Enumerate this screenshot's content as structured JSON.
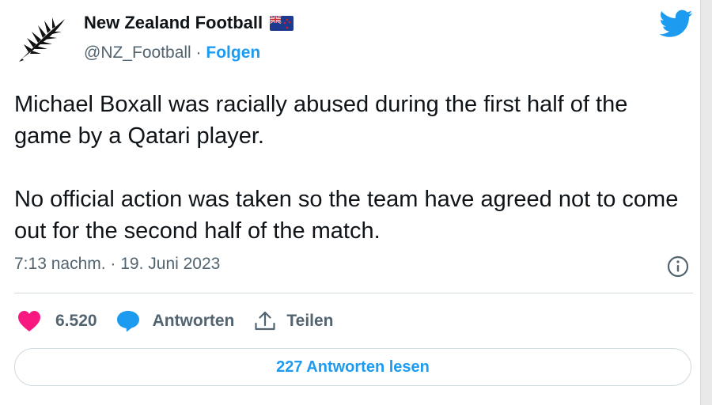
{
  "account": {
    "name": "New Zealand Football",
    "handle": "@NZ_Football",
    "separator": "·",
    "follow_label": "Folgen",
    "avatar_icon": "silver-fern-logo",
    "flag_icon": "new-zealand-flag"
  },
  "tweet": {
    "paragraphs": [
      "Michael Boxall was racially abused during the first half of the game by a Qatari player.",
      "No official action was taken so the team have agreed not to come out for the second half of the match."
    ],
    "timestamp": "7:13 nachm. · 19. Juni 2023"
  },
  "actions": {
    "like": {
      "icon": "heart-icon",
      "count": "6.520",
      "color": "#f91880"
    },
    "reply": {
      "icon": "speech-bubble-icon",
      "label": "Antworten",
      "color": "#1d9bf0"
    },
    "share": {
      "icon": "share-icon",
      "label": "Teilen"
    }
  },
  "read_replies_label": "227 Antworten lesen",
  "colors": {
    "accent": "#1d9bf0",
    "text": "#0f1419",
    "secondary_text": "#536471",
    "border": "#cfd9de"
  }
}
